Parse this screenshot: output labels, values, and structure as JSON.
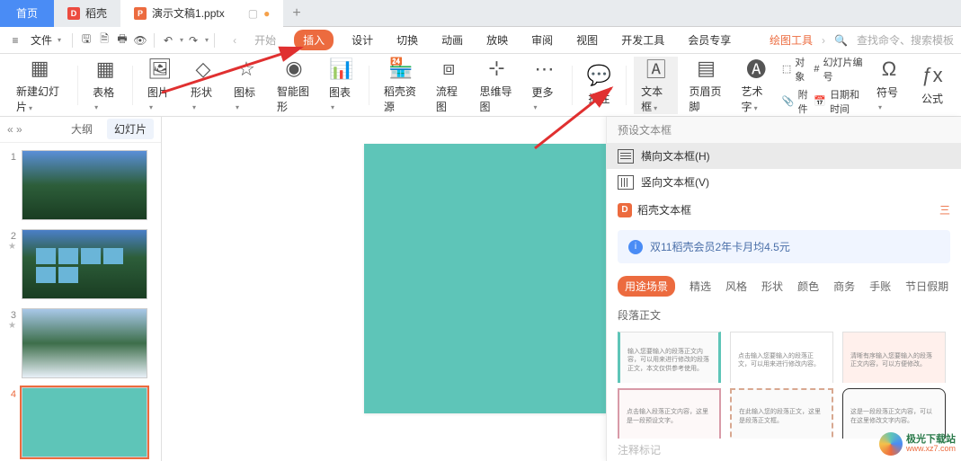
{
  "tabs": {
    "home": "首页",
    "docer": "稻壳",
    "file": "演示文稿1.pptx"
  },
  "menubar": {
    "file_label": "文件"
  },
  "ribbon_tabs": {
    "start": "开始",
    "insert": "插入",
    "design": "设计",
    "transition": "切换",
    "animation": "动画",
    "slideshow": "放映",
    "review": "审阅",
    "view": "视图",
    "dev": "开发工具",
    "vip": "会员专享",
    "draw": "绘图工具"
  },
  "search": {
    "placeholder": "查找命令、搜索模板"
  },
  "ribbon": {
    "new_slide": "新建幻灯片",
    "table": "表格",
    "picture": "图片",
    "shape": "形状",
    "icon": "图标",
    "smartart": "智能图形",
    "chart": "图表",
    "docer_res": "稻壳资源",
    "flowchart": "流程图",
    "mindmap": "思维导图",
    "more": "更多",
    "comment": "批注",
    "textbox": "文本框",
    "header": "页眉页脚",
    "wordart": "艺术字",
    "object": "对象",
    "attachment": "附件",
    "slide_number": "幻灯片编号",
    "datetime": "日期和时间",
    "symbol": "符号",
    "formula": "公式"
  },
  "thumbs": {
    "outline": "大纲",
    "slides": "幻灯片",
    "items": [
      {
        "num": "1"
      },
      {
        "num": "2"
      },
      {
        "num": "3"
      },
      {
        "num": "4"
      }
    ]
  },
  "panel": {
    "preset_title": "预设文本框",
    "horiz": "横向文本框(H)",
    "vert": "竖向文本框(V)",
    "docer_textbox": "稻壳文本框",
    "more_icon": "三",
    "promo": "双11稻壳会员2年卡月均4.5元",
    "filters": {
      "usage": "用途场景",
      "featured": "精选",
      "style": "风格",
      "shape": "形状",
      "color": "颜色",
      "business": "商务",
      "journal": "手账",
      "holiday": "节日假期"
    },
    "paragraph": "段落正文",
    "notes": "注释标记"
  },
  "watermark": {
    "name": "极光下载站",
    "url": "www.xz7.com"
  }
}
